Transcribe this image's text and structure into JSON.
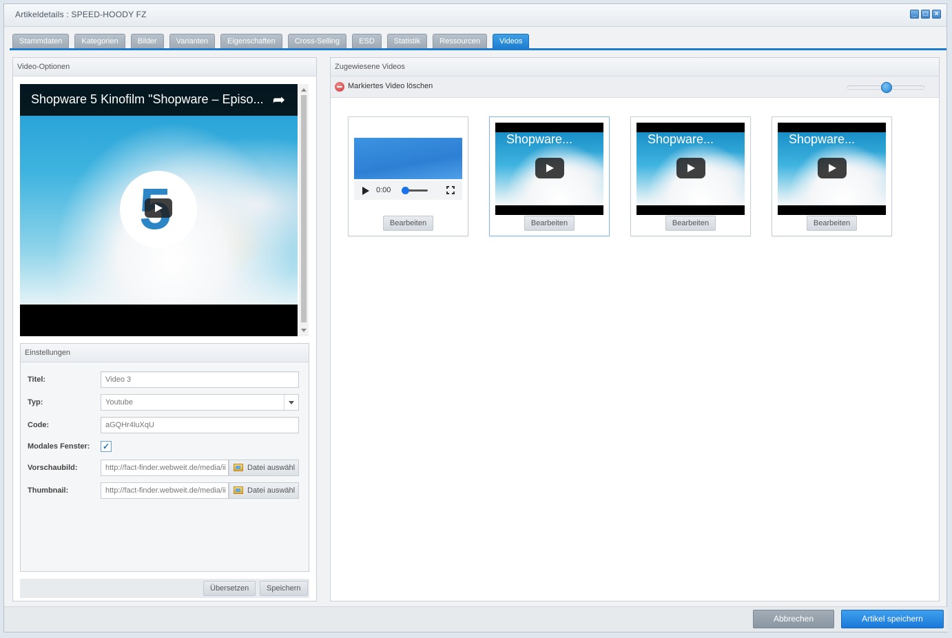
{
  "window": {
    "title": "Artikeldetails : SPEED-HOODY FZ"
  },
  "tabs": [
    {
      "label": "Stammdaten",
      "active": false
    },
    {
      "label": "Kategorien",
      "active": false
    },
    {
      "label": "Bilder",
      "active": false
    },
    {
      "label": "Varianten",
      "active": false
    },
    {
      "label": "Eigenschaften",
      "active": false
    },
    {
      "label": "Cross-Selling",
      "active": false
    },
    {
      "label": "ESD",
      "active": false
    },
    {
      "label": "Statistik",
      "active": false
    },
    {
      "label": "Ressourcen",
      "active": false
    },
    {
      "label": "Videos",
      "active": true
    }
  ],
  "left_panel": {
    "header": "Video-Optionen",
    "preview": {
      "title": "Shopware 5 Kinofilm \"Shopware – Episo...",
      "logo_char": "5"
    },
    "settings": {
      "header": "Einstellungen",
      "fields": {
        "titel": {
          "label": "Titel:",
          "value": "Video 3"
        },
        "typ": {
          "label": "Typ:",
          "value": "Youtube"
        },
        "code": {
          "label": "Code:",
          "value": "aGQHr4luXqU"
        },
        "modal": {
          "label": "Modales Fenster:",
          "checked": true,
          "mark": "✓"
        },
        "vorschaubild": {
          "label": "Vorschaubild:",
          "value": "http://fact-finder.webweit.de/media/ii",
          "button": "Datei auswähl"
        },
        "thumbnail": {
          "label": "Thumbnail:",
          "value": "http://fact-finder.webweit.de/media/ii",
          "button": "Datei auswähl"
        }
      }
    },
    "footer": {
      "translate_label": "Übersetzen",
      "save_label": "Speichern"
    }
  },
  "right_panel": {
    "header": "Zugewiesene Videos",
    "toolbar": {
      "delete_label": "Markiertes Video löschen",
      "zoom_level": 0.5
    },
    "videos": [
      {
        "kind": "audio",
        "time": "0:00",
        "edit_label": "Bearbeiten",
        "selected": false
      },
      {
        "kind": "youtube",
        "title": "Shopware...",
        "edit_label": "Bearbeiten",
        "selected": true
      },
      {
        "kind": "youtube",
        "title": "Shopware...",
        "edit_label": "Bearbeiten",
        "selected": false
      },
      {
        "kind": "youtube",
        "title": "Shopware...",
        "edit_label": "Bearbeiten",
        "selected": false
      }
    ]
  },
  "bottom_bar": {
    "cancel_label": "Abbrechen",
    "save_label": "Artikel speichern"
  },
  "colors": {
    "accent": "#1d7cd0",
    "tab_inactive": "#a9b4bf",
    "delete_red": "#d03535"
  }
}
